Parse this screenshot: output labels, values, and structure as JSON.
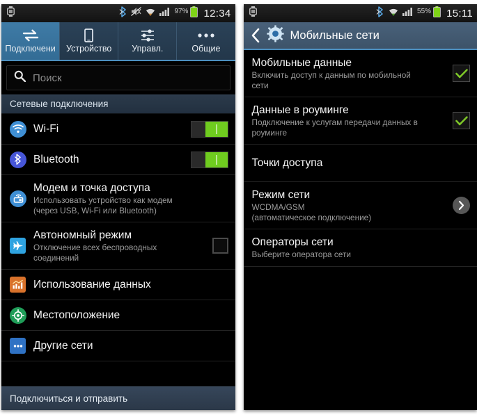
{
  "left_screen": {
    "statusbar": {
      "left_icon": "watch-icon",
      "icons": [
        "bluetooth-icon",
        "sound-mute-icon",
        "wifi-icon",
        "cellular-signal-icon"
      ],
      "battery_percent": "97%",
      "battery_icon": "battery-icon",
      "clock": "12:34"
    },
    "tabs": [
      {
        "label": "Подключени",
        "icon": "connections-arrows-icon",
        "active": true
      },
      {
        "label": "Устройство",
        "icon": "phone-device-icon",
        "active": false
      },
      {
        "label": "Управл.",
        "icon": "sliders-icon",
        "active": false
      },
      {
        "label": "Общие",
        "icon": "more-dots-icon",
        "active": false
      }
    ],
    "search": {
      "icon": "search-icon",
      "placeholder": "Поиск",
      "value": ""
    },
    "section_header": "Сетевые подключения",
    "items": [
      {
        "title": "Wi-Fi",
        "subtitle": "",
        "icon": "wifi-round-icon",
        "icon_color": "#3f8fd4",
        "control": "toggle-on"
      },
      {
        "title": "Bluetooth",
        "subtitle": "",
        "icon": "bluetooth-round-icon",
        "icon_color": "#4756d8",
        "control": "toggle-on"
      },
      {
        "title": "Модем и точка доступа",
        "subtitle": "Использовать устройство как модем (через USB, Wi-Fi или Bluetooth)",
        "icon": "modem-hotspot-icon",
        "icon_color": "#3f8fd4",
        "control": "none"
      },
      {
        "title": "Автономный режим",
        "subtitle": "Отключение всех беспроводных соединений",
        "icon": "airplane-icon",
        "icon_color": "#2fa3e0",
        "control": "checkbox-unchecked"
      },
      {
        "title": "Использование данных",
        "subtitle": "",
        "icon": "data-usage-chart-icon",
        "icon_color": "#d9722b",
        "control": "none"
      },
      {
        "title": "Местоположение",
        "subtitle": "",
        "icon": "location-target-icon",
        "icon_color": "#1f9d58",
        "control": "none"
      },
      {
        "title": "Другие сети",
        "subtitle": "",
        "icon": "more-networks-icon",
        "icon_color": "#2f72c4",
        "control": "none"
      }
    ],
    "bottom_bar_label": "Подключиться и отправить"
  },
  "right_screen": {
    "statusbar": {
      "left_icon": "watch-icon",
      "icons": [
        "bluetooth-icon",
        "wifi-icon",
        "cellular-signal-icon"
      ],
      "battery_percent": "55%",
      "battery_icon": "battery-icon",
      "clock": "15:11"
    },
    "header": {
      "back_icon": "back-chevron-icon",
      "app_icon": "settings-gear-icon",
      "title": "Мобильные сети"
    },
    "items": [
      {
        "title": "Мобильные данные",
        "subtitle": "Включить доступ к данным по мобильной сети",
        "control": "checkbox-checked"
      },
      {
        "title": "Данные в роуминге",
        "subtitle": "Подключение к услугам передачи данных в роуминге",
        "control": "checkbox-checked"
      },
      {
        "title": "Точки доступа",
        "subtitle": "",
        "control": "none"
      },
      {
        "title": "Режим сети",
        "subtitle": "WCDMA/GSM\n(автоматическое подключение)",
        "control": "chevron-right"
      },
      {
        "title": "Операторы сети",
        "subtitle": "Выберите оператора сети",
        "control": "none"
      }
    ]
  },
  "colors": {
    "accent_blue": "#4c8fbf",
    "tab_active": "#3f7ba6",
    "toggle_green": "#6fcc1f",
    "check_green": "#7ec728",
    "background": "#000000"
  }
}
